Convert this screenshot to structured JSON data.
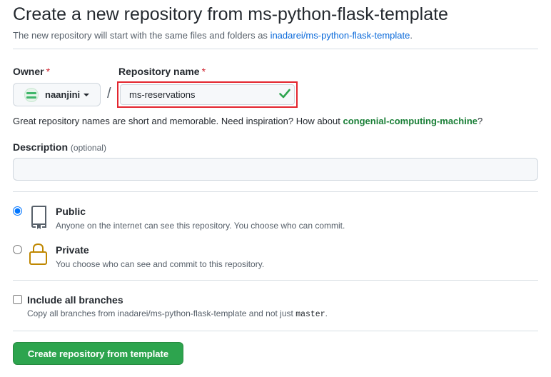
{
  "header": {
    "title": "Create a new repository from ms-python-flask-template",
    "subtitle_prefix": "The new repository will start with the same files and folders as",
    "template_link": "inadarei/ms-python-flask-template",
    "subtitle_suffix": "."
  },
  "owner": {
    "label": "Owner",
    "required_mark": "*",
    "selected": "naanjini"
  },
  "separator": "/",
  "repo_name": {
    "label": "Repository name",
    "required_mark": "*",
    "value": "ms-reservations"
  },
  "name_hint": {
    "text": "Great repository names are short and memorable. Need inspiration? How about",
    "suggestion": "congenial-computing-machine",
    "end": "?"
  },
  "description": {
    "label": "Description",
    "optional": "(optional)",
    "value": ""
  },
  "visibility": {
    "public": {
      "label": "Public",
      "desc": "Anyone on the internet can see this repository. You choose who can commit.",
      "checked": true
    },
    "private": {
      "label": "Private",
      "desc": "You choose who can see and commit to this repository.",
      "checked": false
    }
  },
  "branches": {
    "label": "Include all branches",
    "desc_prefix": "Copy all branches from inadarei/ms-python-flask-template and not just",
    "desc_code": "master",
    "desc_suffix": "."
  },
  "submit": {
    "label": "Create repository from template"
  },
  "colors": {
    "accent_green": "#2da44e",
    "link_blue": "#0969da",
    "required_red": "#cf222e",
    "highlight_red": "#e3252e",
    "lock_gold": "#bf8700"
  }
}
